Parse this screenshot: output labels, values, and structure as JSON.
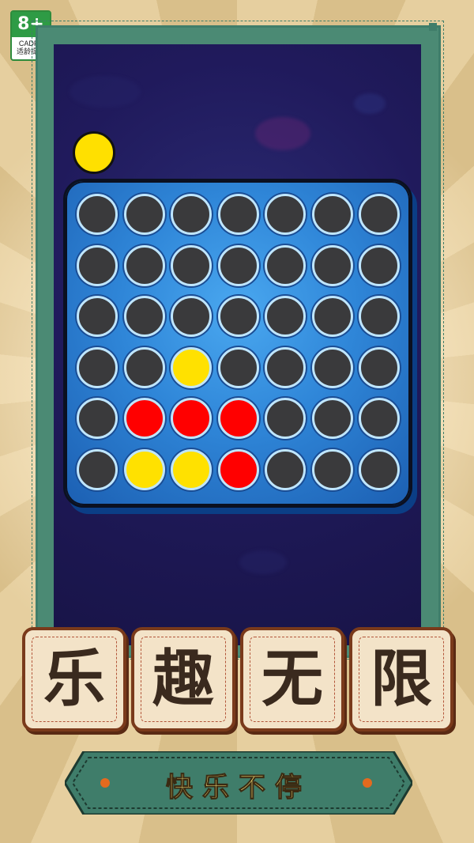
{
  "age_rating": {
    "value": "8+",
    "org": "CADPA",
    "label": "适龄提示"
  },
  "game": {
    "next_piece_color": "yellow",
    "board": {
      "rows": 6,
      "cols": 7,
      "cells": [
        [
          "empty",
          "empty",
          "empty",
          "empty",
          "empty",
          "empty",
          "empty"
        ],
        [
          "empty",
          "empty",
          "empty",
          "empty",
          "empty",
          "empty",
          "empty"
        ],
        [
          "empty",
          "empty",
          "empty",
          "empty",
          "empty",
          "empty",
          "empty"
        ],
        [
          "empty",
          "empty",
          "yellow",
          "empty",
          "empty",
          "empty",
          "empty"
        ],
        [
          "empty",
          "red",
          "red",
          "red",
          "empty",
          "empty",
          "empty"
        ],
        [
          "empty",
          "yellow",
          "yellow",
          "red",
          "empty",
          "empty",
          "empty"
        ]
      ]
    }
  },
  "title_tiles": [
    "乐",
    "趣",
    "无",
    "限"
  ],
  "tagline": "快乐不停",
  "colors": {
    "red": "#ff0000",
    "yellow": "#ffe100",
    "empty": "#3a3a3c",
    "frame": "#3f7d6a",
    "board": "#2f86d8"
  }
}
